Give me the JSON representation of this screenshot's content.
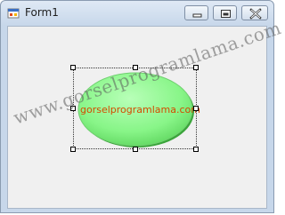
{
  "window": {
    "title": "Form1",
    "icon": "winforms-form-icon",
    "buttons": {
      "minimize": "minimize-icon",
      "maximize": "maximize-icon",
      "close": "close-icon"
    }
  },
  "canvas": {
    "ellipse_label": "gorselprogramlama.com",
    "ellipse_fill": "#88f588",
    "label_color": "#d44a00"
  },
  "watermark": {
    "text": "www.gorselprogramlama.com"
  }
}
